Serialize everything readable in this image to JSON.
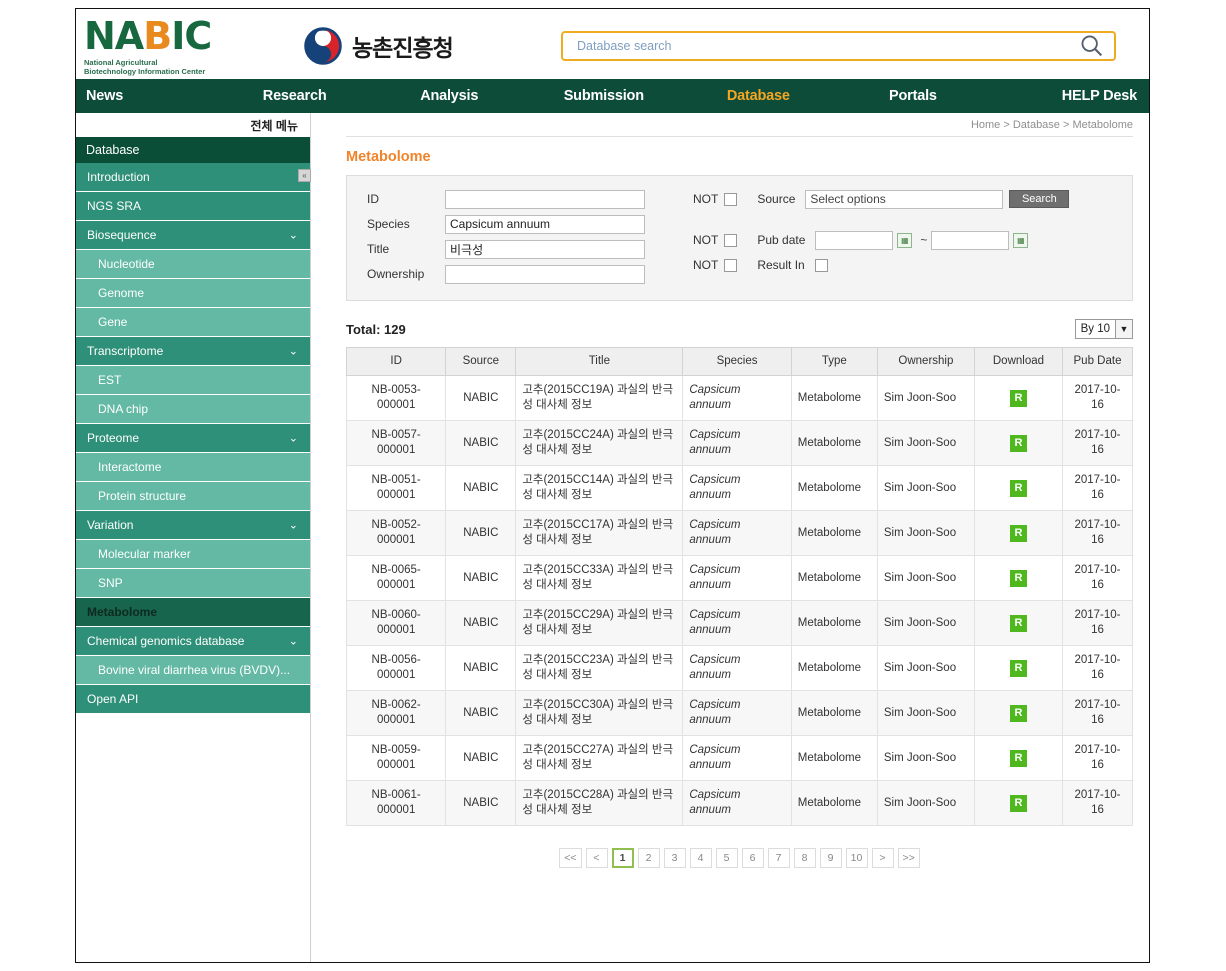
{
  "header": {
    "logo_main_1": "NA",
    "logo_main_2": "B",
    "logo_main_3": "IC",
    "logo_sub_line1": "National Agricultural",
    "logo_sub_line2": "Biotechnology Information Center",
    "rda_text": "농촌진흥청",
    "rda_logo_name": "rda-circle-logo"
  },
  "search": {
    "placeholder": "Database search",
    "value": "",
    "icon": "search-icon"
  },
  "nav": {
    "items": [
      {
        "label": "News",
        "active": false
      },
      {
        "label": "Research",
        "active": false
      },
      {
        "label": "Analysis",
        "active": false
      },
      {
        "label": "Submission",
        "active": false
      },
      {
        "label": "Database",
        "active": true
      },
      {
        "label": "Portals",
        "active": false
      },
      {
        "label": "HELP Desk",
        "active": false
      }
    ]
  },
  "sidebar": {
    "all_menu_label": "전체 메뉴",
    "title": "Database",
    "collapse_label": "«",
    "items": [
      {
        "label": "Introduction",
        "level": 1,
        "chevron": false,
        "active": false
      },
      {
        "label": "NGS SRA",
        "level": 1,
        "chevron": false,
        "active": false
      },
      {
        "label": "Biosequence",
        "level": 1,
        "chevron": true,
        "active": false
      },
      {
        "label": "Nucleotide",
        "level": 2,
        "chevron": false,
        "active": false
      },
      {
        "label": "Genome",
        "level": 2,
        "chevron": false,
        "active": false
      },
      {
        "label": "Gene",
        "level": 2,
        "chevron": false,
        "active": false
      },
      {
        "label": "Transcriptome",
        "level": 1,
        "chevron": true,
        "active": false
      },
      {
        "label": "EST",
        "level": 2,
        "chevron": false,
        "active": false
      },
      {
        "label": "DNA chip",
        "level": 2,
        "chevron": false,
        "active": false
      },
      {
        "label": "Proteome",
        "level": 1,
        "chevron": true,
        "active": false
      },
      {
        "label": "Interactome",
        "level": 2,
        "chevron": false,
        "active": false
      },
      {
        "label": "Protein structure",
        "level": 2,
        "chevron": false,
        "active": false
      },
      {
        "label": "Variation",
        "level": 1,
        "chevron": true,
        "active": false
      },
      {
        "label": "Molecular marker",
        "level": 2,
        "chevron": false,
        "active": false
      },
      {
        "label": "SNP",
        "level": 2,
        "chevron": false,
        "active": false
      },
      {
        "label": "Metabolome",
        "level": 1,
        "chevron": false,
        "active": true
      },
      {
        "label": "Chemical genomics database",
        "level": 1,
        "chevron": true,
        "active": false
      },
      {
        "label": "Bovine viral diarrhea virus (BVDV)...",
        "level": 2,
        "chevron": false,
        "active": false
      },
      {
        "label": "Open API",
        "level": 1,
        "chevron": false,
        "active": false
      }
    ]
  },
  "breadcrumb": "Home > Database > Metabolome",
  "page_title": "Metabolome",
  "form": {
    "id_label": "ID",
    "id_value": "",
    "species_label": "Species",
    "species_value": "Capsicum annuum",
    "title_label": "Title",
    "title_value": "비극성",
    "ownership_label": "Ownership",
    "ownership_value": "",
    "not_label": "NOT",
    "source_label": "Source",
    "source_value": "Select options",
    "search_button": "Search",
    "pubdate_label": "Pub date",
    "pubdate_from": "",
    "pubdate_to": "",
    "tilde": "~",
    "result_in_label": "Result In",
    "calendar_icon": "calendar-icon"
  },
  "results": {
    "total_label": "Total: 129",
    "per_page_label": "By 10",
    "per_page_arrow": "▼",
    "columns": [
      "ID",
      "Source",
      "Title",
      "Species",
      "Type",
      "Ownership",
      "Download",
      "Pub Date"
    ],
    "download_badge": "R",
    "rows": [
      {
        "id": "NB-0053-000001",
        "source": "NABIC",
        "title": "고추(2015CC19A) 과실의 반극성 대사체 정보",
        "species": "Capsicum annuum",
        "type": "Metabolome",
        "ownership": "Sim Joon-Soo",
        "download": "R",
        "pub_date": "2017-10-16"
      },
      {
        "id": "NB-0057-000001",
        "source": "NABIC",
        "title": "고추(2015CC24A) 과실의 반극성 대사체 정보",
        "species": "Capsicum annuum",
        "type": "Metabolome",
        "ownership": "Sim Joon-Soo",
        "download": "R",
        "pub_date": "2017-10-16"
      },
      {
        "id": "NB-0051-000001",
        "source": "NABIC",
        "title": "고추(2015CC14A) 과실의 반극성 대사체 정보",
        "species": "Capsicum annuum",
        "type": "Metabolome",
        "ownership": "Sim Joon-Soo",
        "download": "R",
        "pub_date": "2017-10-16"
      },
      {
        "id": "NB-0052-000001",
        "source": "NABIC",
        "title": "고추(2015CC17A) 과실의 반극성 대사체 정보",
        "species": "Capsicum annuum",
        "type": "Metabolome",
        "ownership": "Sim Joon-Soo",
        "download": "R",
        "pub_date": "2017-10-16"
      },
      {
        "id": "NB-0065-000001",
        "source": "NABIC",
        "title": "고추(2015CC33A) 과실의 반극성 대사체 정보",
        "species": "Capsicum annuum",
        "type": "Metabolome",
        "ownership": "Sim Joon-Soo",
        "download": "R",
        "pub_date": "2017-10-16"
      },
      {
        "id": "NB-0060-000001",
        "source": "NABIC",
        "title": "고추(2015CC29A) 과실의 반극성 대사체 정보",
        "species": "Capsicum annuum",
        "type": "Metabolome",
        "ownership": "Sim Joon-Soo",
        "download": "R",
        "pub_date": "2017-10-16"
      },
      {
        "id": "NB-0056-000001",
        "source": "NABIC",
        "title": "고추(2015CC23A) 과실의 반극성 대사체 정보",
        "species": "Capsicum annuum",
        "type": "Metabolome",
        "ownership": "Sim Joon-Soo",
        "download": "R",
        "pub_date": "2017-10-16"
      },
      {
        "id": "NB-0062-000001",
        "source": "NABIC",
        "title": "고추(2015CC30A) 과실의 반극성 대사체 정보",
        "species": "Capsicum annuum",
        "type": "Metabolome",
        "ownership": "Sim Joon-Soo",
        "download": "R",
        "pub_date": "2017-10-16"
      },
      {
        "id": "NB-0059-000001",
        "source": "NABIC",
        "title": "고추(2015CC27A) 과실의 반극성 대사체 정보",
        "species": "Capsicum annuum",
        "type": "Metabolome",
        "ownership": "Sim Joon-Soo",
        "download": "R",
        "pub_date": "2017-10-16"
      },
      {
        "id": "NB-0061-000001",
        "source": "NABIC",
        "title": "고추(2015CC28A) 과실의 반극성 대사체 정보",
        "species": "Capsicum annuum",
        "type": "Metabolome",
        "ownership": "Sim Joon-Soo",
        "download": "R",
        "pub_date": "2017-10-16"
      }
    ]
  },
  "pagination": {
    "buttons": [
      {
        "label": "<<",
        "name": "first",
        "active": false
      },
      {
        "label": "<",
        "name": "prev",
        "active": false
      },
      {
        "label": "1",
        "name": "page-1",
        "active": true
      },
      {
        "label": "2",
        "name": "page-2",
        "active": false
      },
      {
        "label": "3",
        "name": "page-3",
        "active": false
      },
      {
        "label": "4",
        "name": "page-4",
        "active": false
      },
      {
        "label": "5",
        "name": "page-5",
        "active": false
      },
      {
        "label": "6",
        "name": "page-6",
        "active": false
      },
      {
        "label": "7",
        "name": "page-7",
        "active": false
      },
      {
        "label": "8",
        "name": "page-8",
        "active": false
      },
      {
        "label": "9",
        "name": "page-9",
        "active": false
      },
      {
        "label": "10",
        "name": "page-10",
        "active": false
      },
      {
        "label": ">",
        "name": "next",
        "active": false
      },
      {
        "label": ">>",
        "name": "last",
        "active": false
      }
    ]
  },
  "colors": {
    "nav_bg": "#0c4c38",
    "nav_active": "#f5a623",
    "sidebar_item": "#2e9078",
    "sidebar_sub": "#63b9a4",
    "sidebar_active": "#17654c",
    "title_orange": "#f0842a",
    "search_border": "#f0ac20",
    "badge_green": "#4fb81e",
    "id_link": "#5aa868"
  }
}
